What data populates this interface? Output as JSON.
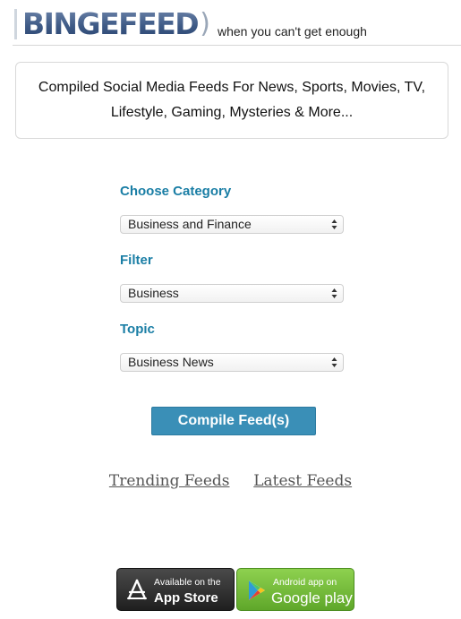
{
  "header": {
    "logo_text": "BINGEFEED",
    "logo_paren": ")",
    "tagline": "when you can't get enough"
  },
  "intro": {
    "text": "Compiled Social Media Feeds For News, Sports, Movies, TV, Lifestyle, Gaming, Mysteries & More..."
  },
  "form": {
    "category_label": "Choose Category",
    "category_value": "Business and Finance",
    "filter_label": "Filter",
    "filter_value": "Business",
    "topic_label": "Topic",
    "topic_value": "Business News",
    "compile_button": "Compile Feed(s)"
  },
  "links": {
    "trending": "Trending Feeds",
    "latest": "Latest Feeds"
  },
  "badges": {
    "appstore_small": "Available on the",
    "appstore_big": "App Store",
    "googleplay_small": "Android app on",
    "googleplay_big": "Google play"
  },
  "colors": {
    "label": "#1a7ea5",
    "button": "#3a8fb7",
    "googleplay": "#6cb534"
  }
}
